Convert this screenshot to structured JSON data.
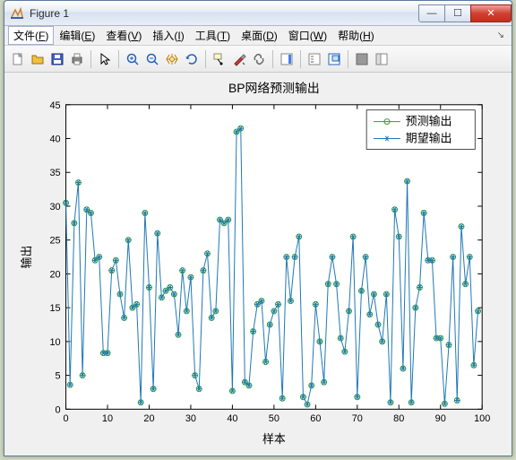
{
  "window": {
    "title": "Figure 1",
    "buttons": {
      "min": "—",
      "max": "☐",
      "close": "✕"
    }
  },
  "menu": {
    "items": [
      {
        "label": "文件",
        "key": "F"
      },
      {
        "label": "编辑",
        "key": "E"
      },
      {
        "label": "查看",
        "key": "V"
      },
      {
        "label": "插入",
        "key": "I"
      },
      {
        "label": "工具",
        "key": "T"
      },
      {
        "label": "桌面",
        "key": "D"
      },
      {
        "label": "窗口",
        "key": "W"
      },
      {
        "label": "帮助",
        "key": "H"
      }
    ]
  },
  "toolbar_icons": [
    "new-icon",
    "open-icon",
    "save-icon",
    "print-icon",
    "sep",
    "pointer-icon",
    "sep",
    "zoom-in-icon",
    "zoom-out-icon",
    "pan-icon",
    "rotate-icon",
    "sep",
    "datatip-icon",
    "brush-icon",
    "link-icon",
    "sep",
    "colorbar-icon",
    "sep",
    "legend-icon",
    "insert-axes-icon",
    "sep",
    "hide-icon",
    "show-icon"
  ],
  "chart_data": {
    "type": "line",
    "title": "BP网络预测输出",
    "xlabel": "样本",
    "ylabel": "输出",
    "xlim": [
      0,
      100
    ],
    "ylim": [
      0,
      45
    ],
    "xticks": [
      0,
      10,
      20,
      30,
      40,
      50,
      60,
      70,
      80,
      90,
      100
    ],
    "yticks": [
      0,
      5,
      10,
      15,
      20,
      25,
      30,
      35,
      40,
      45
    ],
    "x": [
      0,
      1,
      2,
      3,
      4,
      5,
      6,
      7,
      8,
      9,
      10,
      11,
      12,
      13,
      14,
      15,
      16,
      17,
      18,
      19,
      20,
      21,
      22,
      23,
      24,
      25,
      26,
      27,
      28,
      29,
      30,
      31,
      32,
      33,
      34,
      35,
      36,
      37,
      38,
      39,
      40,
      41,
      42,
      43,
      44,
      45,
      46,
      47,
      48,
      49,
      50,
      51,
      52,
      53,
      54,
      55,
      56,
      57,
      58,
      59,
      60,
      61,
      62,
      63,
      64,
      65,
      66,
      67,
      68,
      69,
      70,
      71,
      72,
      73,
      74,
      75,
      76,
      77,
      78,
      79,
      80,
      81,
      82,
      83,
      84,
      85,
      86,
      87,
      88,
      89,
      90,
      91,
      92,
      93,
      94,
      95,
      96,
      97,
      98,
      99
    ],
    "series": [
      {
        "name": "预测输出",
        "marker": "o",
        "color": "#2ca02c",
        "values": [
          30.5,
          3.6,
          27.5,
          33.5,
          5.0,
          29.5,
          29.0,
          22.0,
          22.5,
          8.3,
          8.3,
          20.5,
          22.0,
          17.0,
          13.5,
          25.0,
          15.0,
          15.5,
          1.0,
          29.0,
          18.0,
          3.0,
          26.0,
          16.5,
          17.5,
          18.0,
          17.0,
          11.0,
          20.5,
          14.5,
          19.5,
          5.0,
          3.0,
          20.5,
          23.0,
          13.5,
          14.5,
          28.0,
          27.5,
          28.0,
          2.7,
          41.0,
          41.5,
          4.0,
          3.5,
          11.5,
          15.5,
          16.0,
          7.0,
          12.5,
          14.5,
          15.5,
          1.6,
          22.5,
          16.0,
          22.5,
          25.5,
          1.8,
          0.7,
          3.5,
          15.5,
          10.0,
          4.0,
          18.5,
          22.5,
          18.5,
          10.5,
          8.5,
          14.5,
          25.5,
          1.8,
          17.5,
          22.5,
          14.0,
          17.0,
          12.5,
          10.0,
          17.0,
          1.0,
          29.5,
          25.5,
          6.0,
          33.7,
          1.0,
          15.0,
          18.0,
          29.0,
          22.0,
          22.0,
          10.5,
          10.5,
          0.8,
          9.5,
          22.5,
          1.3,
          27.0,
          18.5,
          22.5,
          6.5,
          14.5
        ]
      },
      {
        "name": "期望输出",
        "marker": "*",
        "color": "#1f77b4",
        "values": [
          30.5,
          3.6,
          27.5,
          33.5,
          5.0,
          29.5,
          29.0,
          22.0,
          22.5,
          8.3,
          8.3,
          20.5,
          22.0,
          17.0,
          13.5,
          25.0,
          15.0,
          15.5,
          1.0,
          29.0,
          18.0,
          3.0,
          26.0,
          16.5,
          17.5,
          18.0,
          17.0,
          11.0,
          20.5,
          14.5,
          19.5,
          5.0,
          3.0,
          20.5,
          23.0,
          13.5,
          14.5,
          28.0,
          27.5,
          28.0,
          2.7,
          41.0,
          41.5,
          4.0,
          3.5,
          11.5,
          15.5,
          16.0,
          7.0,
          12.5,
          14.5,
          15.5,
          1.6,
          22.5,
          16.0,
          22.5,
          25.5,
          1.8,
          0.7,
          3.5,
          15.5,
          10.0,
          4.0,
          18.5,
          22.5,
          18.5,
          10.5,
          8.5,
          14.5,
          25.5,
          1.8,
          17.5,
          22.5,
          14.0,
          17.0,
          12.5,
          10.0,
          17.0,
          1.0,
          29.5,
          25.5,
          6.0,
          33.7,
          1.0,
          15.0,
          18.0,
          29.0,
          22.0,
          22.0,
          10.5,
          10.5,
          0.8,
          9.5,
          22.5,
          1.3,
          27.0,
          18.5,
          22.5,
          6.5,
          14.5
        ]
      }
    ]
  }
}
